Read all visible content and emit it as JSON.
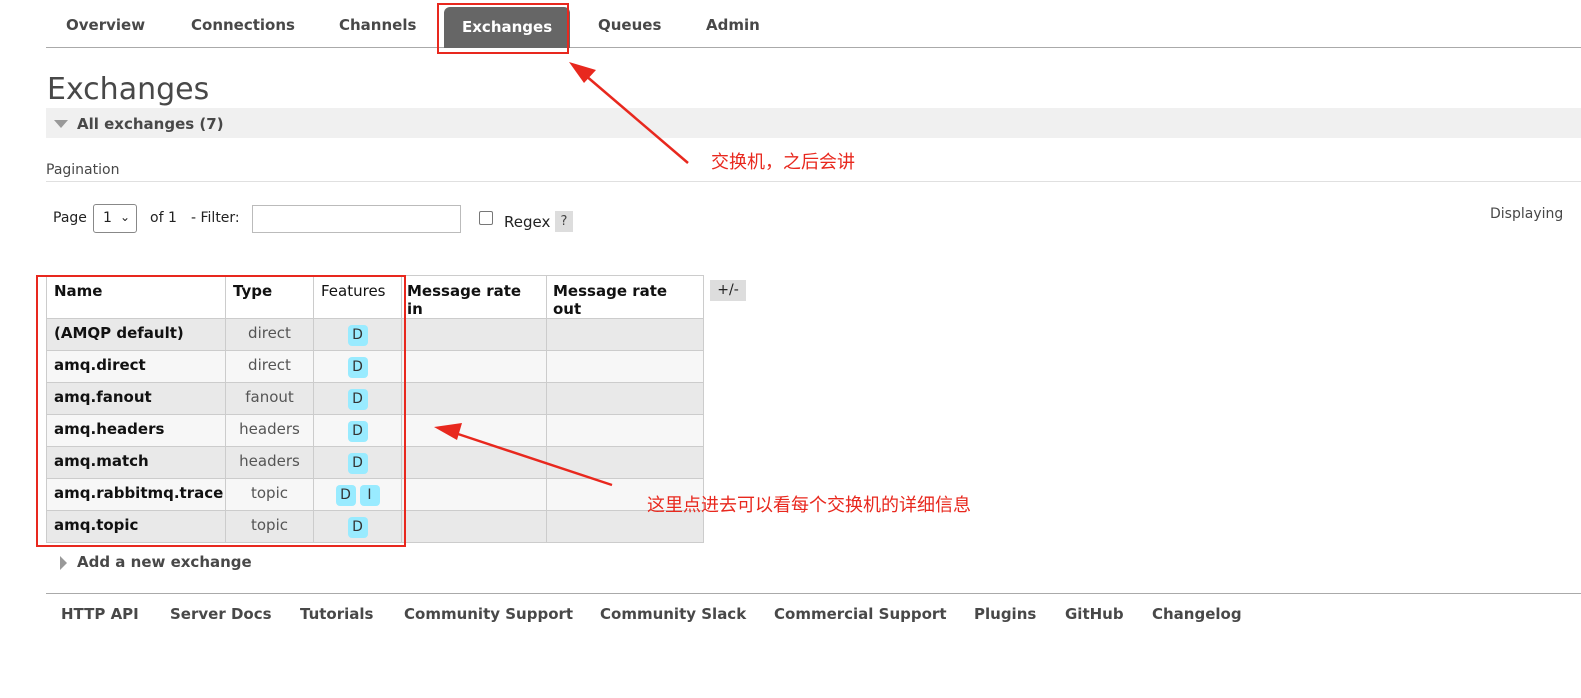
{
  "tabs": [
    "Overview",
    "Connections",
    "Channels",
    "Exchanges",
    "Queues",
    "Admin"
  ],
  "page_title": "Exchanges",
  "section_title": "All exchanges (7)",
  "pagination": {
    "label": "Pagination",
    "page_label": "Page",
    "page_value": "1",
    "of_label": "of 1",
    "filter_label": "- Filter:",
    "filter_value": "",
    "regex_label": "Regex",
    "help": "?",
    "displaying": "Displaying"
  },
  "table": {
    "headers": [
      "Name",
      "Type",
      "Features",
      "Message rate in",
      "Message rate out"
    ],
    "toggle": "+/-",
    "rows": [
      {
        "name": "(AMQP default)",
        "type": "direct",
        "features": [
          "D"
        ]
      },
      {
        "name": "amq.direct",
        "type": "direct",
        "features": [
          "D"
        ]
      },
      {
        "name": "amq.fanout",
        "type": "fanout",
        "features": [
          "D"
        ]
      },
      {
        "name": "amq.headers",
        "type": "headers",
        "features": [
          "D"
        ]
      },
      {
        "name": "amq.match",
        "type": "headers",
        "features": [
          "D"
        ]
      },
      {
        "name": "amq.rabbitmq.trace",
        "type": "topic",
        "features": [
          "D",
          "I"
        ]
      },
      {
        "name": "amq.topic",
        "type": "topic",
        "features": [
          "D"
        ]
      }
    ]
  },
  "add_exchange": "Add a new exchange",
  "footer": [
    "HTTP API",
    "Server Docs",
    "Tutorials",
    "Community Support",
    "Community Slack",
    "Commercial Support",
    "Plugins",
    "GitHub",
    "Changelog"
  ],
  "annotations": {
    "tab_note": "交换机，之后会讲",
    "table_note": "这里点进去可以看每个交换机的详细信息"
  },
  "colors": {
    "annotation_red": "#e8281e",
    "active_tab": "#666666",
    "feature_badge": "#99ebff"
  }
}
